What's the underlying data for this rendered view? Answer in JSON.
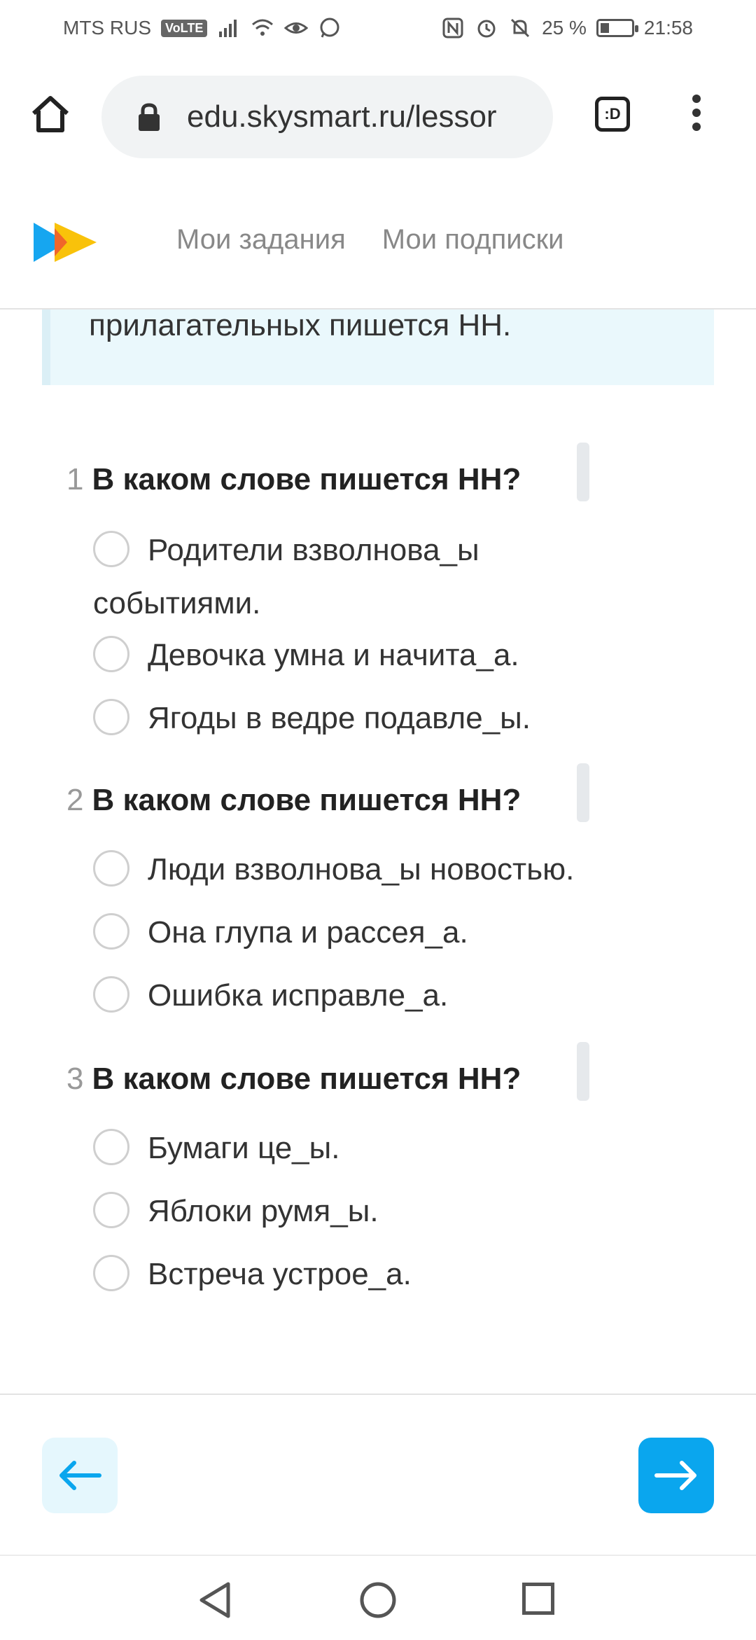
{
  "status_bar": {
    "carrier": "MTS RUS",
    "volte": "VoLTE",
    "battery": "25 %",
    "battery_level": 0.25,
    "time": "21:58"
  },
  "browser": {
    "url": "edu.skysmart.ru/lessor",
    "tabs_label": ":D"
  },
  "site": {
    "nav": [
      "Мои задания",
      "Мои подписки"
    ]
  },
  "info_box": {
    "text": "прилагательных пишется НН."
  },
  "questions": [
    {
      "number": "1",
      "title": "В каком слове пишется НН?",
      "options": [
        "Родители взволнова_ы событиями.",
        "Девочка умна и начита_а.",
        "Ягоды в ведре подавле_ы."
      ]
    },
    {
      "number": "2",
      "title": "В каком слове пишется НН?",
      "options": [
        "Люди взволнова_ы новостью.",
        "Она глупа и рассея_а.",
        "Ошибка исправле_а."
      ]
    },
    {
      "number": "3",
      "title": "В каком слове пишется НН?",
      "options": [
        "Бумаги це_ы.",
        "Яблоки румя_ы.",
        "Встреча устрое_а."
      ]
    }
  ],
  "colors": {
    "accent": "#0aa6ee",
    "accent_light": "#e5f7fd",
    "info_bg": "#eaf8fc"
  }
}
